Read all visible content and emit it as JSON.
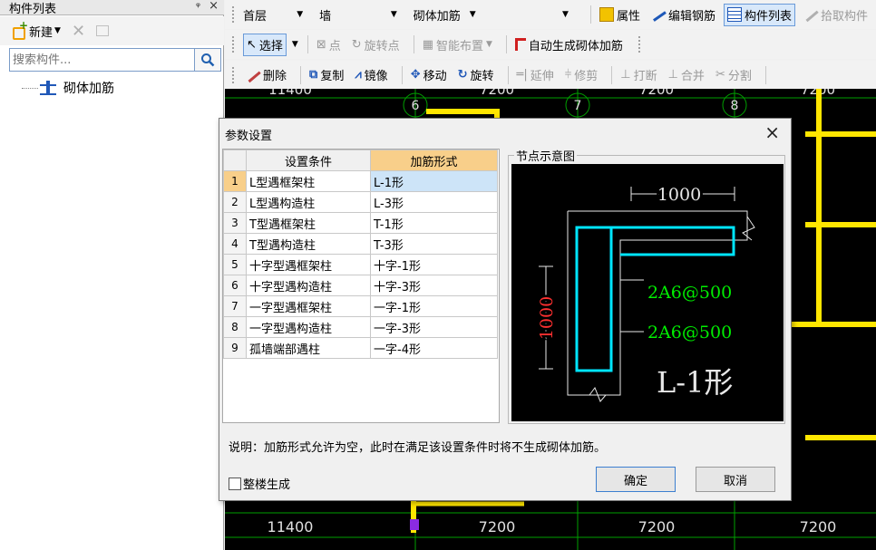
{
  "left_panel": {
    "title": "构件列表",
    "pin": "ᵠ",
    "close": "×",
    "new_label": "新建",
    "search_placeholder": "搜索构件...",
    "tree_item": "砌体加筋"
  },
  "toolbar1": {
    "floor": "首层",
    "type": "墙",
    "subtype": "砌体加筋",
    "properties": "属性",
    "edit_rebar": "编辑钢筋",
    "component_list": "构件列表",
    "pick_component": "拾取构件"
  },
  "toolbar2": {
    "select": "选择",
    "point": "点",
    "rotate_point": "旋转点",
    "smart_layout": "智能布置",
    "auto_generate": "自动生成砌体加筋"
  },
  "toolbar3": {
    "delete": "删除",
    "copy": "复制",
    "mirror": "镜像",
    "move": "移动",
    "rotate": "旋转",
    "extend": "延伸",
    "trim": "修剪",
    "break": "打断",
    "merge": "合并",
    "split": "分割"
  },
  "cad": {
    "axis_labels": [
      "6",
      "7",
      "8"
    ],
    "dims_top": [
      "11400",
      "7200",
      "7200",
      "7200"
    ],
    "dims_bottom": [
      "11400",
      "7200",
      "7200",
      "7200"
    ]
  },
  "dialog": {
    "title": "参数设置",
    "close": "×",
    "col_condition": "设置条件",
    "col_form": "加筋形式",
    "rows": [
      {
        "idx": "1",
        "condition": "L型遇框架柱",
        "form": "L-1形"
      },
      {
        "idx": "2",
        "condition": "L型遇构造柱",
        "form": "L-3形"
      },
      {
        "idx": "3",
        "condition": "T型遇框架柱",
        "form": "T-1形"
      },
      {
        "idx": "4",
        "condition": "T型遇构造柱",
        "form": "T-3形"
      },
      {
        "idx": "5",
        "condition": "十字型遇框架柱",
        "form": "十字-1形"
      },
      {
        "idx": "6",
        "condition": "十字型遇构造柱",
        "form": "十字-3形"
      },
      {
        "idx": "7",
        "condition": "一字型遇框架柱",
        "form": "一字-1形"
      },
      {
        "idx": "8",
        "condition": "一字型遇构造柱",
        "form": "一字-3形"
      },
      {
        "idx": "9",
        "condition": "孤墙端部遇柱",
        "form": "一字-4形"
      }
    ],
    "node_group_label": "节点示意图",
    "diagram": {
      "dim_horizontal": "1000",
      "dim_vertical": "1000",
      "rebar_1": "2A6@500",
      "rebar_2": "2A6@500",
      "shape_label": "L-1形"
    },
    "note": "说明：加筋形式允许为空，此时在满足该设置条件时将不生成砌体加筋。",
    "whole_building": "整楼生成",
    "ok": "确定",
    "cancel": "取消"
  },
  "colors": {
    "cad_bg": "#000000",
    "wall_yellow": "#ffe600",
    "rebar_cyan": "#00e5ff",
    "rebar_green": "#00ee00",
    "dim_red": "#ff3030",
    "selected_header": "#f8cf8a"
  }
}
